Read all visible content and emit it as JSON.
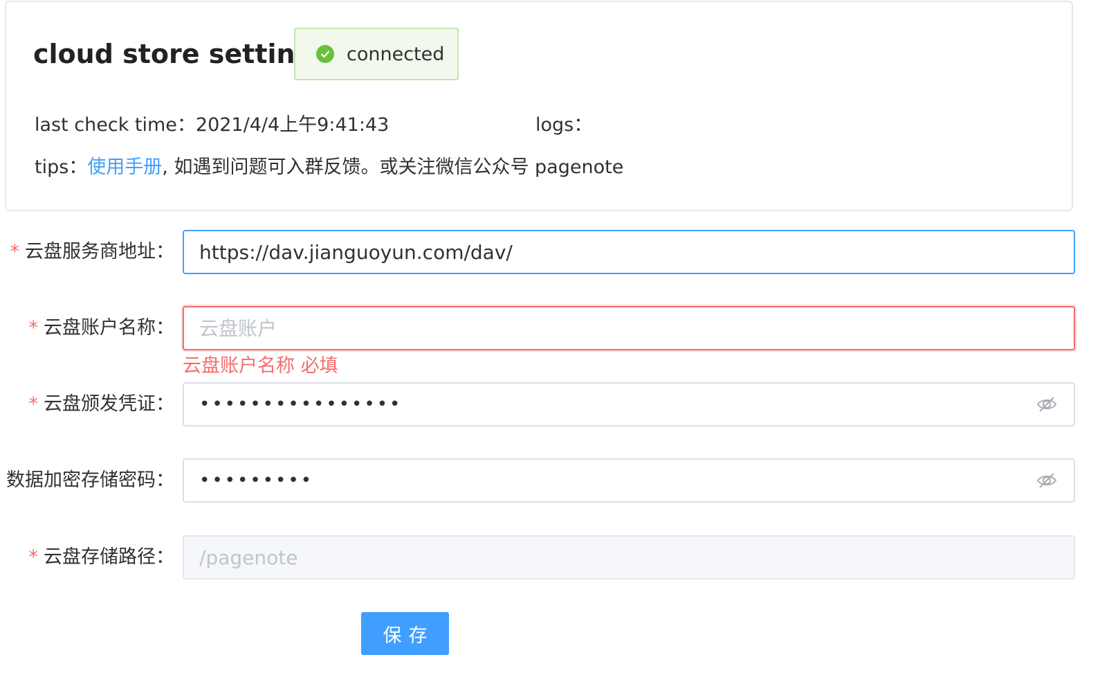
{
  "header": {
    "title": "cloud store setting",
    "status": "connected",
    "last_check_label": "last check time：",
    "last_check_value": "2021/4/4上午9:41:43",
    "logs_label": "logs：",
    "tips_label": "tips：",
    "tips_link": "使用手册",
    "tips_text": ", 如遇到问题可入群反馈。或关注微信公众号 pagenote"
  },
  "form": {
    "required_mark": "*",
    "server": {
      "label": "云盘服务商地址：",
      "value": "https://dav.jianguoyun.com/dav/"
    },
    "account": {
      "label": "云盘账户名称：",
      "value": "",
      "placeholder": "云盘账户",
      "error": "云盘账户名称 必填"
    },
    "credential": {
      "label": "云盘颁发凭证：",
      "value": "abcdefghijklmnop"
    },
    "encrypt": {
      "label": "数据加密存储密码：",
      "value": "abcdefghi"
    },
    "path": {
      "label": "云盘存储路径：",
      "value": "",
      "placeholder": "/pagenote"
    },
    "save_label": "保存"
  },
  "colors": {
    "primary": "#409eff",
    "success": "#67c23a",
    "danger": "#f56c6c",
    "text": "#303133"
  },
  "icons": {
    "status": "check-circle-icon",
    "password_toggle": "eye-off-icon"
  }
}
